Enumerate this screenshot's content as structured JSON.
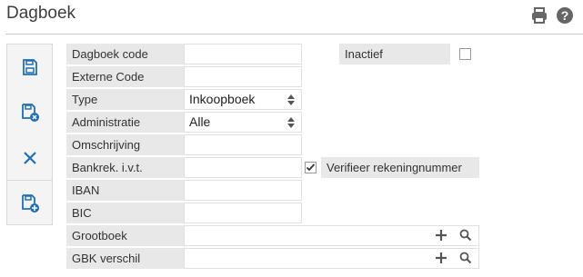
{
  "page": {
    "title": "Dagboek"
  },
  "header_icons": [
    "printer-icon",
    "help-icon"
  ],
  "toolbar": {
    "buttons": [
      "save-icon",
      "save-and-close-icon",
      "close-icon",
      "save-and-new-icon"
    ]
  },
  "form": {
    "dagboek_code": {
      "label": "Dagboek code",
      "value": ""
    },
    "inactief": {
      "label": "Inactief",
      "checked": false
    },
    "externe_code": {
      "label": "Externe Code",
      "value": ""
    },
    "type": {
      "label": "Type",
      "value": "Inkoopboek"
    },
    "administratie": {
      "label": "Administratie",
      "value": "Alle"
    },
    "omschrijving": {
      "label": "Omschrijving",
      "value": ""
    },
    "bankrek": {
      "label": "Bankrek. i.v.t.",
      "value": ""
    },
    "verifieer": {
      "label": "Verifieer rekeningnummer",
      "checked": true
    },
    "iban": {
      "label": "IBAN",
      "value": ""
    },
    "bic": {
      "label": "BIC",
      "value": ""
    },
    "grootboek": {
      "label": "Grootboek",
      "value": ""
    },
    "gbk_verschil": {
      "label": "GBK verschil",
      "value": ""
    }
  },
  "colors": {
    "accent": "#1e6fb8",
    "label_bg": "#e8e8e8",
    "toolbar_bg": "#f4f4f4"
  }
}
